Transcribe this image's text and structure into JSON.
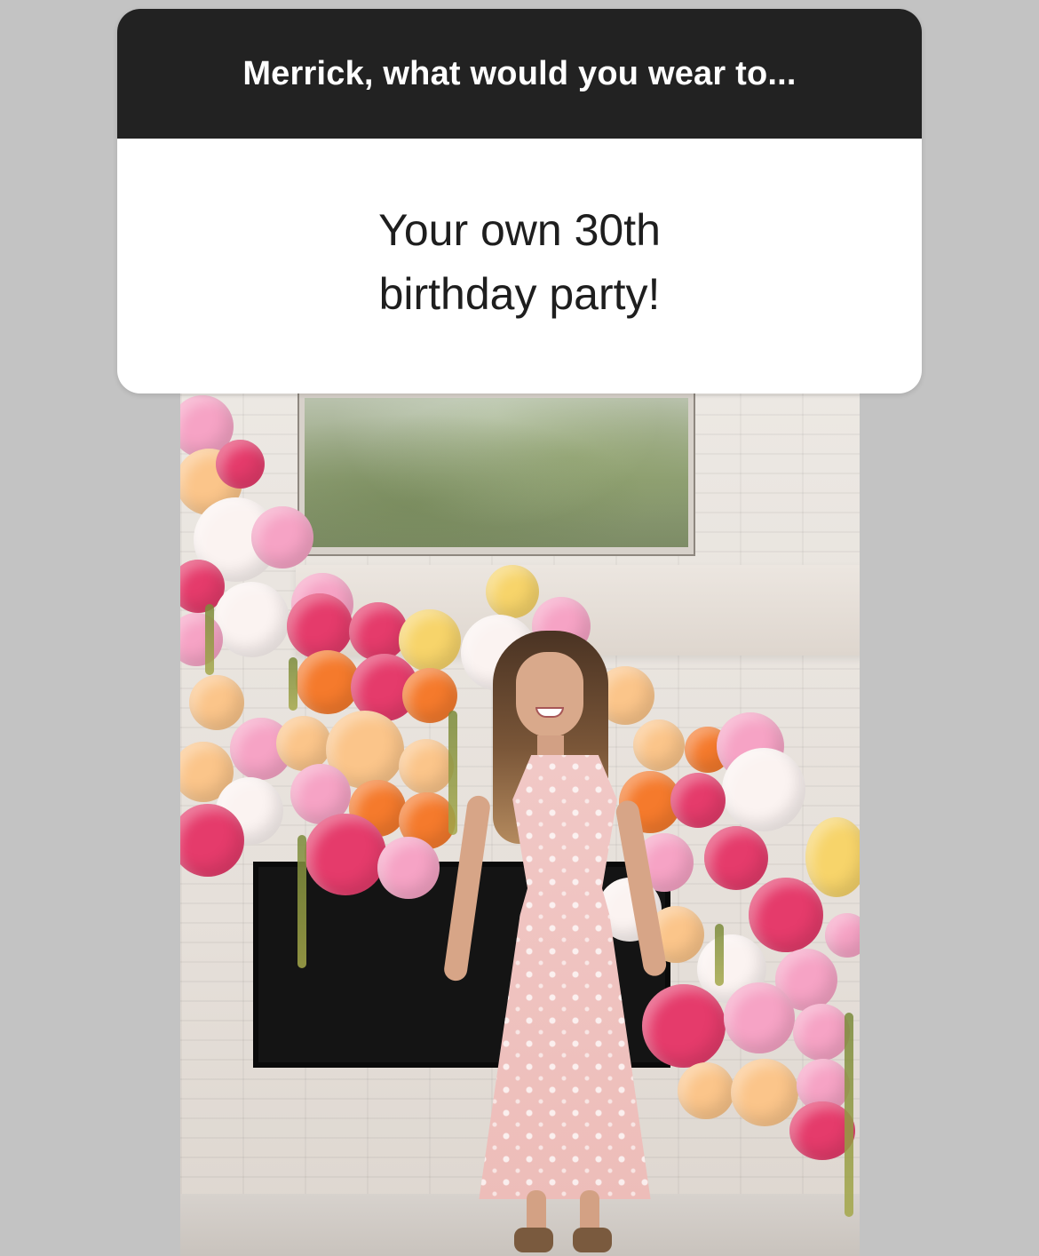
{
  "sticker": {
    "question": "Merrick, what would you wear to...",
    "answer": "Your own 30th birthday party!"
  },
  "colors": {
    "background": "#c3c3c3",
    "sticker_header_bg": "#222222",
    "sticker_body_bg": "#ffffff",
    "balloon_pink": "#e53b6b",
    "balloon_light_pink": "#f6a3c5",
    "balloon_orange": "#f57a2c",
    "balloon_peach": "#fbc58a",
    "balloon_yellow": "#f7d46a",
    "balloon_white": "#fbf3f1"
  }
}
